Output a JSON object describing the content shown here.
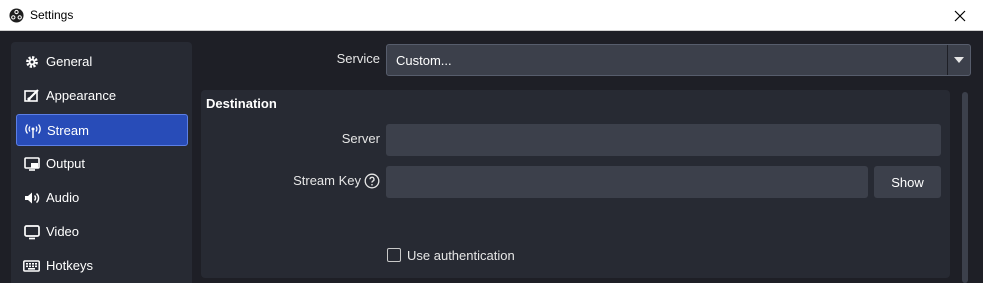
{
  "window": {
    "title": "Settings",
    "close_icon": "close-icon"
  },
  "sidebar": {
    "items": [
      {
        "label": "General",
        "icon": "gear-icon",
        "active": false
      },
      {
        "label": "Appearance",
        "icon": "brush-icon",
        "active": false
      },
      {
        "label": "Stream",
        "icon": "broadcast-icon",
        "active": true
      },
      {
        "label": "Output",
        "icon": "output-icon",
        "active": false
      },
      {
        "label": "Audio",
        "icon": "speaker-icon",
        "active": false
      },
      {
        "label": "Video",
        "icon": "monitor-icon",
        "active": false
      },
      {
        "label": "Hotkeys",
        "icon": "keyboard-icon",
        "active": false
      }
    ]
  },
  "service": {
    "label": "Service",
    "value": "Custom..."
  },
  "destination": {
    "title": "Destination",
    "server_label": "Server",
    "server_value": "",
    "stream_key_label": "Stream Key",
    "stream_key_value": "",
    "show_label": "Show",
    "use_auth_label": "Use authentication",
    "use_auth_checked": false
  },
  "colors": {
    "accent": "#284cb8",
    "background": "#1e1f26",
    "panel": "#272a33",
    "field": "#3c404b"
  }
}
